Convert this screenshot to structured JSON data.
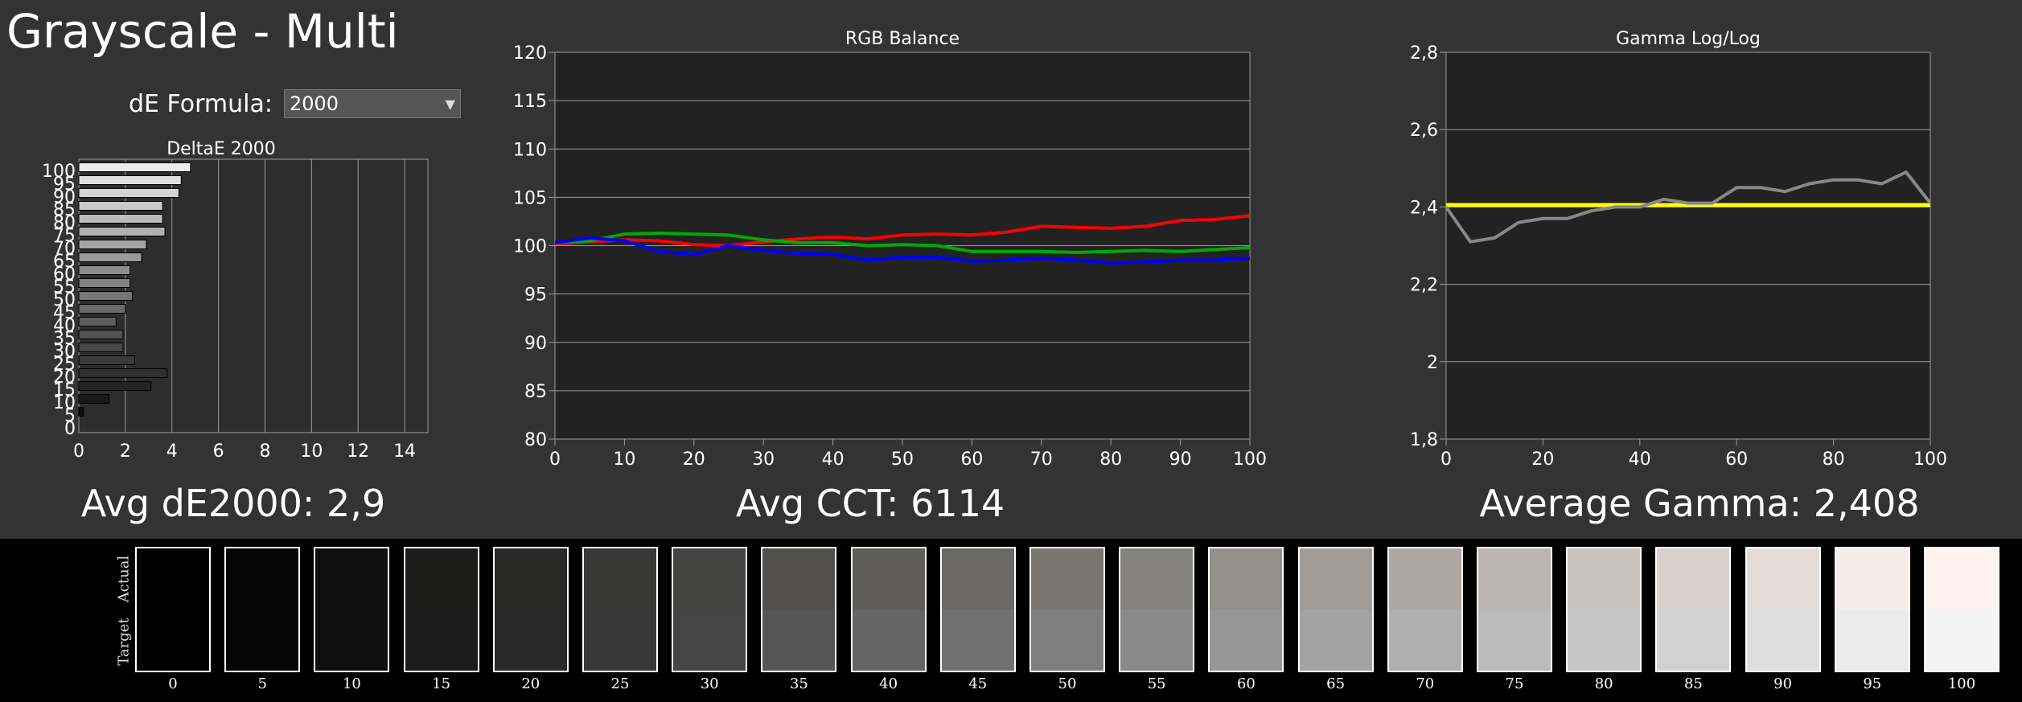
{
  "page": {
    "title": "Grayscale - Multi",
    "de_formula_label": "dE Formula:",
    "de_formula_value": "2000",
    "summaries": {
      "avg_de": "Avg dE2000: 2,9",
      "avg_cct": "Avg CCT: 6114",
      "avg_gamma": "Average Gamma: 2,408"
    }
  },
  "chart_data": [
    {
      "type": "bar",
      "orientation": "horizontal",
      "title": "DeltaE 2000",
      "categories": [
        "0",
        "5",
        "10",
        "15",
        "20",
        "25",
        "30",
        "35",
        "40",
        "45",
        "50",
        "55",
        "60",
        "65",
        "70",
        "75",
        "80",
        "85",
        "90",
        "95",
        "100"
      ],
      "values": [
        0,
        0.2,
        1.3,
        3.1,
        3.8,
        2.4,
        1.9,
        1.9,
        1.6,
        2.0,
        2.3,
        2.2,
        2.2,
        2.7,
        2.9,
        3.7,
        3.6,
        3.6,
        4.3,
        4.4,
        4.8
      ],
      "xlim": [
        0,
        15
      ],
      "xticks": [
        "0",
        "2",
        "4",
        "6",
        "8",
        "10",
        "12",
        "14"
      ],
      "grid": true
    },
    {
      "type": "line",
      "title": "RGB Balance",
      "x": [
        0,
        5,
        10,
        15,
        20,
        25,
        30,
        35,
        40,
        45,
        50,
        55,
        60,
        65,
        70,
        75,
        80,
        85,
        90,
        95,
        100
      ],
      "ylim": [
        80,
        120
      ],
      "xlim": [
        0,
        100
      ],
      "xticks": [
        "0",
        "10",
        "20",
        "30",
        "40",
        "50",
        "60",
        "70",
        "80",
        "90",
        "100"
      ],
      "yticks": [
        "80",
        "85",
        "90",
        "95",
        "100",
        "105",
        "110",
        "115",
        "120"
      ],
      "grid": true,
      "series": [
        {
          "color": "#ff0000",
          "values": [
            100.2,
            100.4,
            100.6,
            100.5,
            100.1,
            100.0,
            100.4,
            100.7,
            100.9,
            100.7,
            101.1,
            101.2,
            101.1,
            101.4,
            102.0,
            101.9,
            101.8,
            102.0,
            102.6,
            102.7,
            103.1
          ]
        },
        {
          "color": "#00aa00",
          "values": [
            100.3,
            100.5,
            101.2,
            101.3,
            101.2,
            101.1,
            100.6,
            100.3,
            100.3,
            100.0,
            100.1,
            100.0,
            99.4,
            99.4,
            99.4,
            99.3,
            99.4,
            99.5,
            99.4,
            99.6,
            99.8
          ]
        },
        {
          "color": "#0000ff",
          "values": [
            100.3,
            100.8,
            100.5,
            99.4,
            99.1,
            100.0,
            99.5,
            99.2,
            99.1,
            98.5,
            98.8,
            98.8,
            98.4,
            98.5,
            98.7,
            98.5,
            98.2,
            98.3,
            98.5,
            98.5,
            98.7
          ]
        }
      ]
    },
    {
      "type": "line",
      "title": "Gamma Log/Log",
      "ylim": [
        1.8,
        2.8
      ],
      "xlim": [
        0,
        100
      ],
      "xticks": [
        "0",
        "20",
        "40",
        "60",
        "80",
        "100"
      ],
      "yticks": [
        "1,8",
        "2",
        "2,2",
        "2,4",
        "2,6",
        "2,8"
      ],
      "grid": true,
      "series": [
        {
          "color": "#ffff00",
          "x": [
            0,
            100
          ],
          "values": [
            2.405,
            2.405
          ]
        },
        {
          "color": "#888888",
          "x": [
            0,
            5,
            10,
            15,
            20,
            25,
            30,
            35,
            40,
            45,
            50,
            55,
            60,
            65,
            70,
            75,
            80,
            85,
            90,
            95,
            100
          ],
          "values": [
            2.4,
            2.31,
            2.32,
            2.36,
            2.37,
            2.37,
            2.39,
            2.4,
            2.4,
            2.42,
            2.41,
            2.41,
            2.45,
            2.45,
            2.44,
            2.46,
            2.47,
            2.47,
            2.46,
            2.49,
            2.41
          ]
        }
      ]
    }
  ],
  "swatches": {
    "actual_label": "Actual",
    "target_label": "Target",
    "items": [
      {
        "label": "0",
        "actual": "#000000",
        "target": "#000000"
      },
      {
        "label": "5",
        "actual": "#050505",
        "target": "#050505"
      },
      {
        "label": "10",
        "actual": "#0f100f",
        "target": "#0f0f0f"
      },
      {
        "label": "15",
        "actual": "#1b1c1a",
        "target": "#1b1b1b"
      },
      {
        "label": "20",
        "actual": "#292a27",
        "target": "#292929"
      },
      {
        "label": "25",
        "actual": "#383836",
        "target": "#383838"
      },
      {
        "label": "30",
        "actual": "#434342",
        "target": "#454545"
      },
      {
        "label": "35",
        "actual": "#52504c",
        "target": "#555555"
      },
      {
        "label": "40",
        "actual": "#5f5e5b",
        "target": "#646464"
      },
      {
        "label": "45",
        "actual": "#6b6966",
        "target": "#717171"
      },
      {
        "label": "50",
        "actual": "#7a7772",
        "target": "#7e7e7e"
      },
      {
        "label": "55",
        "actual": "#85837f",
        "target": "#8a8a8a"
      },
      {
        "label": "60",
        "actual": "#94908c",
        "target": "#979797"
      },
      {
        "label": "65",
        "actual": "#a19c98",
        "target": "#a3a3a3"
      },
      {
        "label": "70",
        "actual": "#aea7a4",
        "target": "#afafaf"
      },
      {
        "label": "75",
        "actual": "#bdb5b3",
        "target": "#bababa"
      },
      {
        "label": "80",
        "actual": "#c9c2bf",
        "target": "#c6c6c6"
      },
      {
        "label": "85",
        "actual": "#d9cfcd",
        "target": "#d2d2d2"
      },
      {
        "label": "90",
        "actual": "#e5dcda",
        "target": "#dedede"
      },
      {
        "label": "95",
        "actual": "#f5ecea",
        "target": "#eaeaea"
      },
      {
        "label": "100",
        "actual": "#fdf2ef",
        "target": "#f4f4f4"
      }
    ]
  }
}
